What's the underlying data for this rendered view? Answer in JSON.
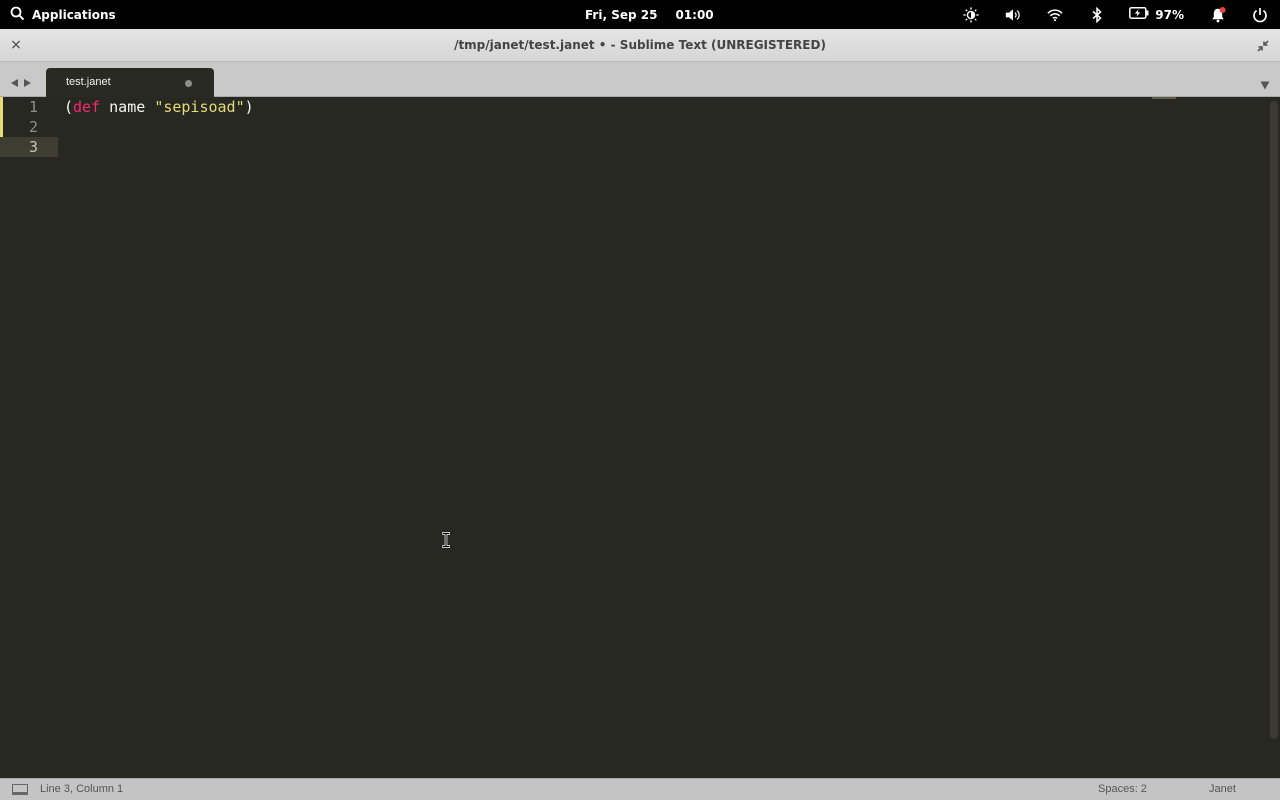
{
  "system_bar": {
    "applications_label": "Applications",
    "date": "Fri, Sep 25",
    "time": "01:00",
    "battery_percent": "97%",
    "icons": [
      "search-icon",
      "brightness-icon",
      "volume-icon",
      "wifi-icon",
      "bluetooth-icon",
      "battery-icon",
      "notification-icon",
      "power-icon"
    ],
    "notification_color": "#e8423f"
  },
  "window": {
    "title": "/tmp/janet/test.janet • - Sublime Text (UNREGISTERED)",
    "close_glyph": "×"
  },
  "tabs": [
    {
      "label": "test.janet",
      "modified": true
    }
  ],
  "editor": {
    "line_numbers": [
      "1",
      "2",
      "3"
    ],
    "lines": [
      {
        "open_paren": "(",
        "keyword": "def",
        "space1": " ",
        "name": "name",
        "space2": " ",
        "string": "\"sepisoad\"",
        "close_paren": ")"
      },
      {},
      {}
    ],
    "theme": {
      "background": "#272822",
      "keyword": "#f92672",
      "string": "#e6db74",
      "text": "#f8f8f2"
    }
  },
  "status_bar": {
    "position": "Line 3, Column 1",
    "indentation": "Spaces: 2",
    "syntax": "Janet"
  }
}
